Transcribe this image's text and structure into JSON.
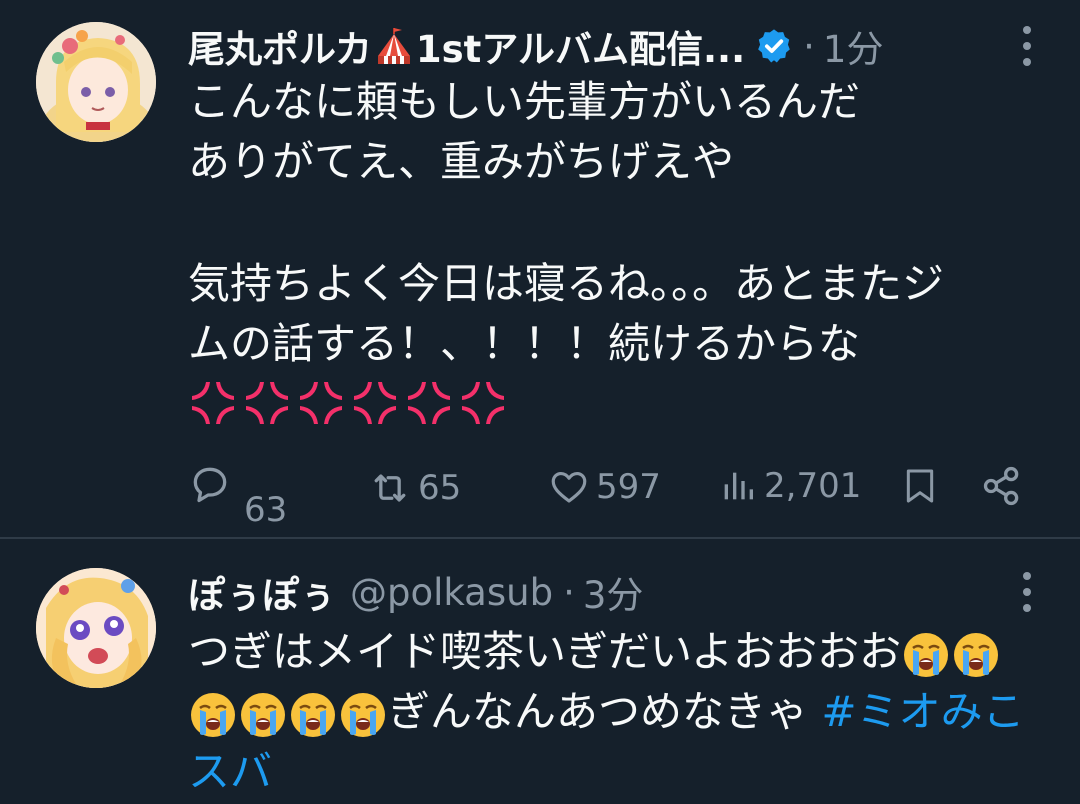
{
  "tweets": [
    {
      "author_name": "尾丸ポルカ",
      "author_name_suffix": "1stアルバム配信...",
      "dot": "·",
      "time": "1分",
      "lines": [
        "こんなに頼もしい先輩方がいるんだ",
        "ありがてえ、重みがちげえや",
        "",
        "気持ちよく今日は寝るね。。。あとまたジ",
        "ムの話する！、！！！続けるからな"
      ],
      "emoji_count": 6,
      "emoji_icon": "anger-symbol-icon",
      "actions": {
        "replies": "63",
        "retweets": "65",
        "likes": "597",
        "views": "2,701"
      }
    },
    {
      "author_name": "ぽぅぽぅ",
      "handle": "@polkasub",
      "dot": "·",
      "time": "3分",
      "line1": "つぎはメイド喫茶いぎだいよおおおお",
      "line2_text": "ぎんなんあつめなきゃ",
      "hashtag_part1": "#ミオみこ",
      "hashtag_part2": "スバ",
      "emoji_icon": "loudly-crying-face-icon"
    }
  ],
  "colors": {
    "background": "#15202b",
    "text": "#f7f9f9",
    "secondary": "#8b98a5",
    "link": "#1d9bf0",
    "verified": "#1d9bf0",
    "anger": "#f4306a"
  }
}
